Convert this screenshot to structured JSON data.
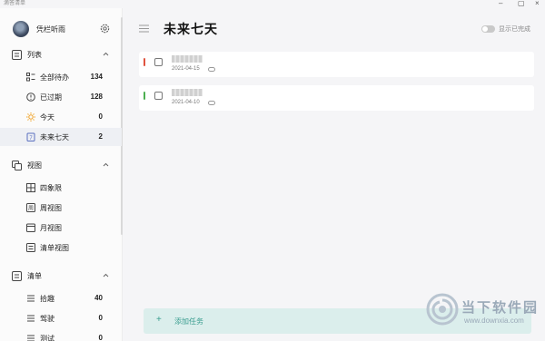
{
  "window": {
    "title": "滴答清单"
  },
  "user": {
    "name": "凭栏听雨"
  },
  "sidebar": {
    "lists_section": {
      "label": "列表"
    },
    "lists": [
      {
        "label": "全部待办",
        "count": "134",
        "icon": "all-tasks-icon"
      },
      {
        "label": "已过期",
        "count": "128",
        "icon": "overdue-icon"
      },
      {
        "label": "今天",
        "count": "0",
        "icon": "sun-icon"
      },
      {
        "label": "未来七天",
        "count": "2",
        "icon": "calendar-7-icon",
        "active": true
      }
    ],
    "views_section": {
      "label": "视图"
    },
    "views": [
      {
        "label": "四象限",
        "icon": "quadrant-icon"
      },
      {
        "label": "周视图",
        "icon": "week-icon"
      },
      {
        "label": "月视图",
        "icon": "month-icon"
      },
      {
        "label": "清单视图",
        "icon": "list-view-icon"
      }
    ],
    "checklists_section": {
      "label": "清单"
    },
    "checklists": [
      {
        "label": "拾趣",
        "count": "40",
        "icon": "list-lines-icon"
      },
      {
        "label": "驾驶",
        "count": "0",
        "icon": "list-lines-icon"
      },
      {
        "label": "测试",
        "count": "0",
        "icon": "list-lines-icon"
      }
    ]
  },
  "main": {
    "title": "未来七天",
    "show_completed_label": "显示已完成",
    "tasks": [
      {
        "date": "2021-04-15",
        "priority_color": "#e0533f"
      },
      {
        "date": "2021-04-10",
        "priority_color": "#4caf50"
      }
    ],
    "add_task_label": "添加任务"
  },
  "watermark": {
    "title": "当下软件园",
    "url": "www.downxia.com"
  },
  "colors": {
    "accent": "#3a9d8f",
    "sidebar_bg": "#fbfbfb",
    "main_bg": "#f5f5f7"
  }
}
